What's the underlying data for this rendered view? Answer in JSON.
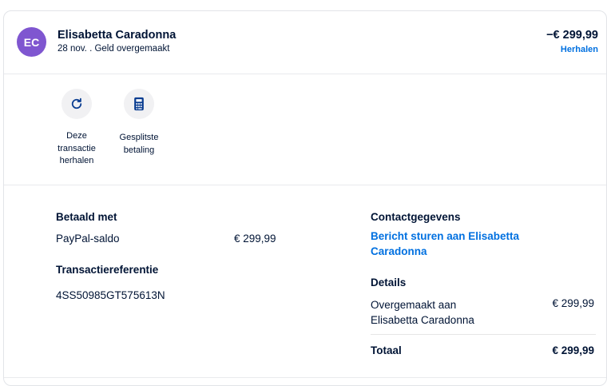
{
  "header": {
    "avatar_initials": "EC",
    "name": "Elisabetta Caradonna",
    "subtitle": "28 nov. . Geld overgemaakt",
    "amount": "−€ 299,99",
    "repeat_link": "Herhalen"
  },
  "actions": [
    {
      "icon": "refresh-icon",
      "label_lines": [
        "Deze",
        "transactie",
        "herhalen"
      ]
    },
    {
      "icon": "calculator-icon",
      "label_lines": [
        "Gesplitste",
        "betaling"
      ]
    }
  ],
  "paid_with": {
    "heading": "Betaald met",
    "method": "PayPal-saldo",
    "amount": "€ 299,99"
  },
  "reference": {
    "heading": "Transactiereferentie",
    "value": "4SS50985GT575613N"
  },
  "contact": {
    "heading": "Contactgegevens",
    "link_lines": [
      "Bericht sturen aan Elisabetta",
      "Caradonna"
    ]
  },
  "details": {
    "heading": "Details",
    "row_label_lines": [
      "Overgemaakt aan",
      "Elisabetta Caradonna"
    ],
    "row_amount": "€ 299,99",
    "total_label": "Totaal",
    "total_amount": "€ 299,99"
  },
  "colors": {
    "avatar_bg": "#7f56d0",
    "link": "#0070e0",
    "text": "#001435"
  }
}
